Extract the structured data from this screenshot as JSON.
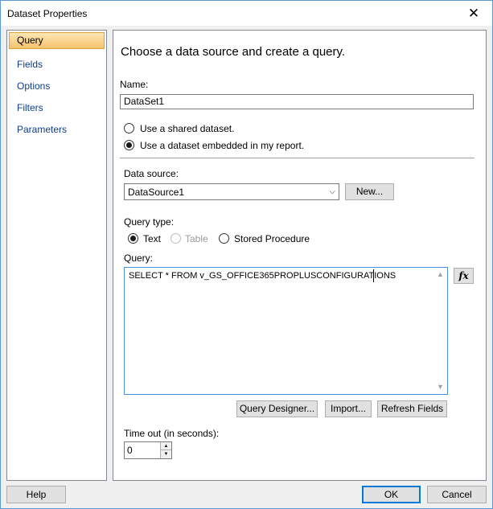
{
  "window": {
    "title": "Dataset Properties",
    "close_glyph": "✕"
  },
  "nav": {
    "items": [
      {
        "label": "Query",
        "selected": true
      },
      {
        "label": "Fields"
      },
      {
        "label": "Options"
      },
      {
        "label": "Filters"
      },
      {
        "label": "Parameters"
      }
    ]
  },
  "panel": {
    "heading": "Choose a data source and create a query.",
    "name_label": "Name:",
    "name_value": "DataSet1",
    "radio_shared": "Use a shared dataset.",
    "radio_embedded": "Use a dataset embedded in my report.",
    "datasource_label": "Data source:",
    "datasource_value": "DataSource1",
    "new_button": "New...",
    "query_type_label": "Query type:",
    "qt_text": "Text",
    "qt_table": "Table",
    "qt_stored": "Stored Procedure",
    "query_label": "Query:",
    "query_value": "SELECT * FROM v_GS_OFFICE365PROPLUSCONFIGURATIONS",
    "fx_label": "fx",
    "query_designer_button": "Query Designer...",
    "import_button": "Import...",
    "refresh_fields_button": "Refresh Fields",
    "timeout_label": "Time out (in seconds):",
    "timeout_value": "0"
  },
  "footer": {
    "help_button": "Help",
    "ok_button": "OK",
    "cancel_button": "Cancel"
  }
}
